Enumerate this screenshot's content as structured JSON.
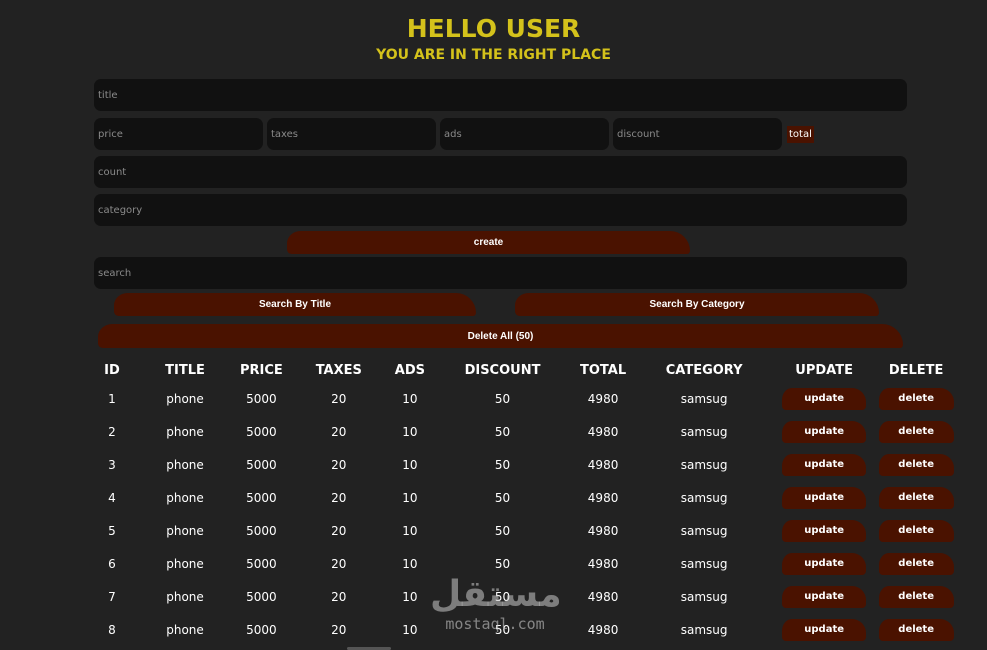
{
  "header": {
    "title": "HELLO USER",
    "subtitle": "YOU ARE IN THE RIGHT PLACE"
  },
  "form": {
    "title_placeholder": "title",
    "price_placeholder": "price",
    "taxes_placeholder": "taxes",
    "ads_placeholder": "ads",
    "discount_placeholder": "discount",
    "total_label": "total",
    "count_placeholder": "count",
    "category_placeholder": "category",
    "create_label": "create"
  },
  "search": {
    "placeholder": "search",
    "by_title_label": "Search By Title",
    "by_category_label": "Search By Category"
  },
  "delete_all_label": "Delete All (50)",
  "table": {
    "headers": [
      "ID",
      "TITLE",
      "PRICE",
      "TAXES",
      "ADS",
      "DISCOUNT",
      "TOTAL",
      "CATEGORY",
      "UPDATE",
      "DELETE"
    ],
    "update_label": "update",
    "delete_label": "delete",
    "rows": [
      [
        "1",
        "phone",
        "5000",
        "20",
        "10",
        "50",
        "4980",
        "samsug"
      ],
      [
        "2",
        "phone",
        "5000",
        "20",
        "10",
        "50",
        "4980",
        "samsug"
      ],
      [
        "3",
        "phone",
        "5000",
        "20",
        "10",
        "50",
        "4980",
        "samsug"
      ],
      [
        "4",
        "phone",
        "5000",
        "20",
        "10",
        "50",
        "4980",
        "samsug"
      ],
      [
        "5",
        "phone",
        "5000",
        "20",
        "10",
        "50",
        "4980",
        "samsug"
      ],
      [
        "6",
        "phone",
        "5000",
        "20",
        "10",
        "50",
        "4980",
        "samsug"
      ],
      [
        "7",
        "phone",
        "5000",
        "20",
        "10",
        "50",
        "4980",
        "samsug"
      ],
      [
        "8",
        "phone",
        "5000",
        "20",
        "10",
        "50",
        "4980",
        "samsug"
      ]
    ]
  },
  "watermark": {
    "arabic": "مستقل",
    "latin": "mostaql.com"
  },
  "colors": {
    "background": "#222222",
    "accent_yellow": "#d4c21b",
    "button_brown": "#4a1200",
    "input_dark": "#111111"
  }
}
